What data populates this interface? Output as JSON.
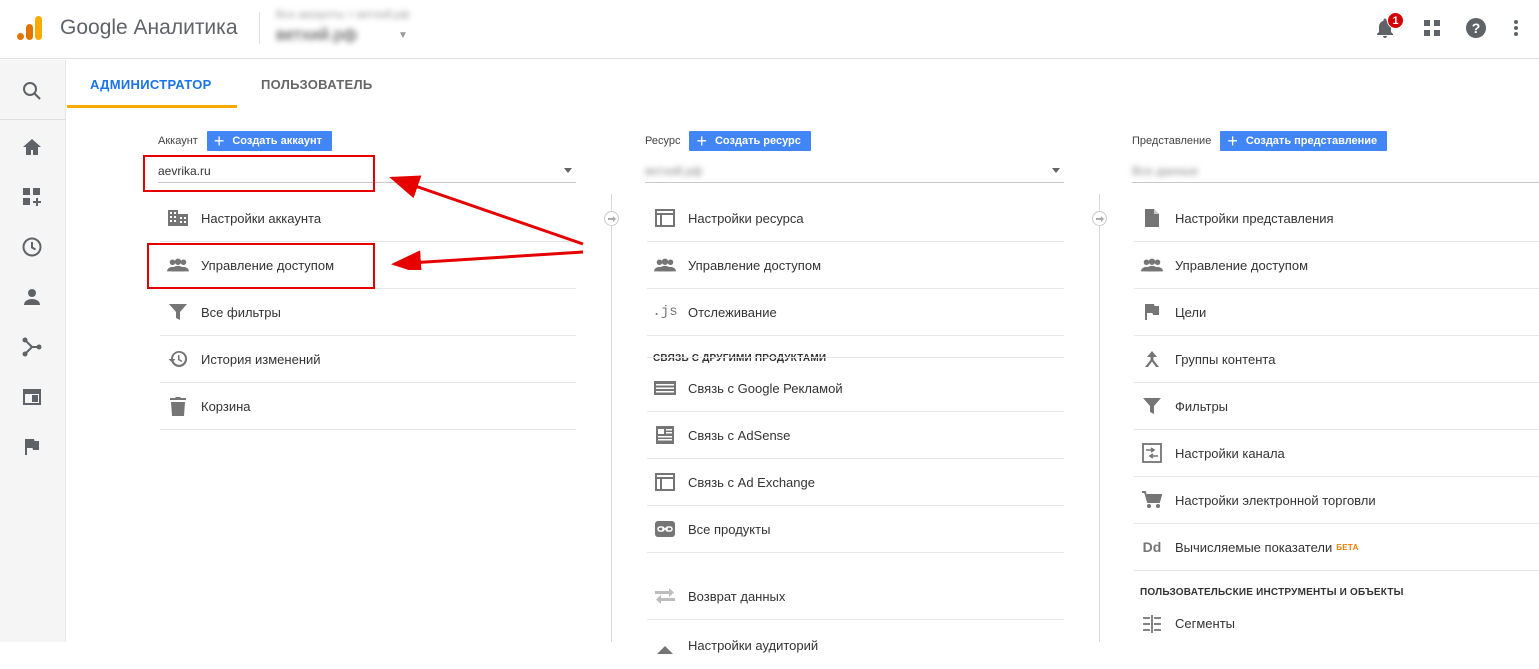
{
  "header": {
    "brand": "Google Аналитика",
    "account_line": "Все аккаунты > ветхий.рф",
    "property_line": "ветхий.рф",
    "notification_count": "1"
  },
  "sidebar": {
    "icons": [
      "search-icon",
      "home-icon",
      "customization-icon",
      "realtime-icon",
      "audience-icon",
      "acquisition-icon",
      "behavior-icon",
      "conversions-icon"
    ]
  },
  "tabs": [
    {
      "label": "АДМИНИСТРАТОР",
      "active": true
    },
    {
      "label": "ПОЛЬЗОВАТЕЛЬ",
      "active": false
    }
  ],
  "account_column": {
    "title": "Аккаунт",
    "create_label": "Создать аккаунт",
    "selected": "aevrika.ru",
    "items": [
      {
        "label": "Настройки аккаунта",
        "icon": "building-icon"
      },
      {
        "label": "Управление доступом",
        "icon": "people-icon"
      },
      {
        "label": "Все фильтры",
        "icon": "filter-icon"
      },
      {
        "label": "История изменений",
        "icon": "history-icon"
      },
      {
        "label": "Корзина",
        "icon": "trash-icon"
      }
    ]
  },
  "property_column": {
    "title": "Ресурс",
    "create_label": "Создать ресурс",
    "selected": "ветхий.рф",
    "items": [
      {
        "label": "Настройки ресурса",
        "icon": "layout-icon"
      },
      {
        "label": "Управление доступом",
        "icon": "people-icon"
      },
      {
        "label": "Отслеживание",
        "icon": "js-icon"
      }
    ],
    "section_title": "СВЯЗЬ С ДРУГИМИ ПРОДУКТАМИ",
    "linked_items": [
      {
        "label": "Связь с Google Рекламой",
        "icon": "ads-icon"
      },
      {
        "label": "Связь с AdSense",
        "icon": "adsense-icon"
      },
      {
        "label": "Связь с Ad Exchange",
        "icon": "adexchange-icon"
      },
      {
        "label": "Все продукты",
        "icon": "link-icon"
      }
    ],
    "more_items": [
      {
        "label": "Возврат данных",
        "icon": "data-return-icon"
      },
      {
        "label": "Настройки аудиторий",
        "icon": "audience-settings-icon"
      }
    ]
  },
  "view_column": {
    "title": "Представление",
    "create_label": "Создать представление",
    "selected": "Все данные",
    "items": [
      {
        "label": "Настройки представления",
        "icon": "document-icon"
      },
      {
        "label": "Управление доступом",
        "icon": "people-icon"
      },
      {
        "label": "Цели",
        "icon": "flag-icon"
      },
      {
        "label": "Группы контента",
        "icon": "content-groups-icon"
      },
      {
        "label": "Фильтры",
        "icon": "filter-icon"
      },
      {
        "label": "Настройки канала",
        "icon": "channel-icon"
      },
      {
        "label": "Настройки электронной торговли",
        "icon": "cart-icon"
      },
      {
        "label": "Вычисляемые показатели",
        "icon": "dd-icon",
        "badge": "БЕТА"
      }
    ],
    "section_title": "ПОЛЬЗОВАТЕЛЬСКИЕ ИНСТРУМЕНТЫ И ОБЪЕКТЫ",
    "tools_items": [
      {
        "label": "Сегменты",
        "icon": "segments-icon"
      }
    ]
  },
  "colors": {
    "accent_blue": "#4285f4",
    "tab_active": "#1a73e8",
    "tab_underline": "#f9ab00",
    "annotation_red": "#e60000"
  }
}
